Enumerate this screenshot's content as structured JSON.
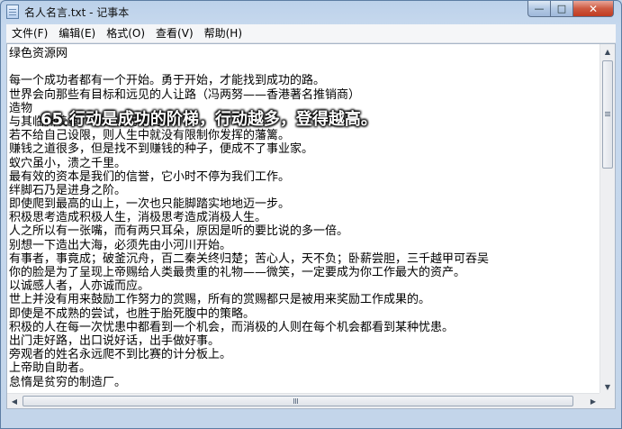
{
  "window": {
    "title": "名人名言.txt - 记事本",
    "min_glyph": "—",
    "max_glyph": "□",
    "close_glyph": "✕"
  },
  "menu": [
    "文件(F)",
    "编辑(E)",
    "格式(O)",
    "查看(V)",
    "帮助(H)"
  ],
  "content": {
    "lines": [
      "绿色资源网",
      "",
      "每一个成功者都有一个开始。勇于开始，才能找到成功的路。",
      "世界会向那些有目标和远见的人让路（冯两努——香港著名推销商）",
      "造物",
      "与其临渊羡鱼，不如退而结网。",
      "若不给自己设限，则人生中就没有限制你发挥的藩篱。",
      "赚钱之道很多，但是找不到赚钱的种子，便成不了事业家。",
      "蚁穴虽小，溃之千里。",
      "最有效的资本是我们的信誉，它小时不停为我们工作。",
      "绊脚石乃是进身之阶。",
      "即使爬到最高的山上，一次也只能脚踏实地地迈一步。",
      "积极思考造成积极人生，消极思考造成消极人生。",
      "人之所以有一张嘴，而有两只耳朵，原因是听的要比说的多一倍。",
      "别想一下造出大海，必须先由小河川开始。",
      "有事者，事竟成；破釜沉舟，百二秦关终归楚；苦心人，天不负；卧薪尝胆，三千越甲可吞吴",
      "你的脸是为了呈现上帝赐给人类最贵重的礼物——微笑，一定要成为你工作最大的资产。",
      "以诚感人者，人亦诚而应。",
      "世上并没有用来鼓励工作努力的赏赐，所有的赏赐都只是被用来奖励工作成果的。",
      "即使是不成熟的尝试，也胜于胎死腹中的策略。",
      "积极的人在每一次忧患中都看到一个机会，而消极的人则在每个机会都看到某种忧患。",
      "出门走好路，出口说好话，出手做好事。",
      "旁观者的姓名永远爬不到比赛的计分板上。",
      "上帝助自助者。",
      "怠惰是贫穷的制造厂。"
    ]
  },
  "overlay": {
    "caption": "65.行动是成功的阶梯，行动越多，登得越高。"
  },
  "scrollbars": {
    "up_glyph": "▲",
    "down_glyph": "▼",
    "left_glyph": "◀",
    "right_glyph": "▶"
  }
}
